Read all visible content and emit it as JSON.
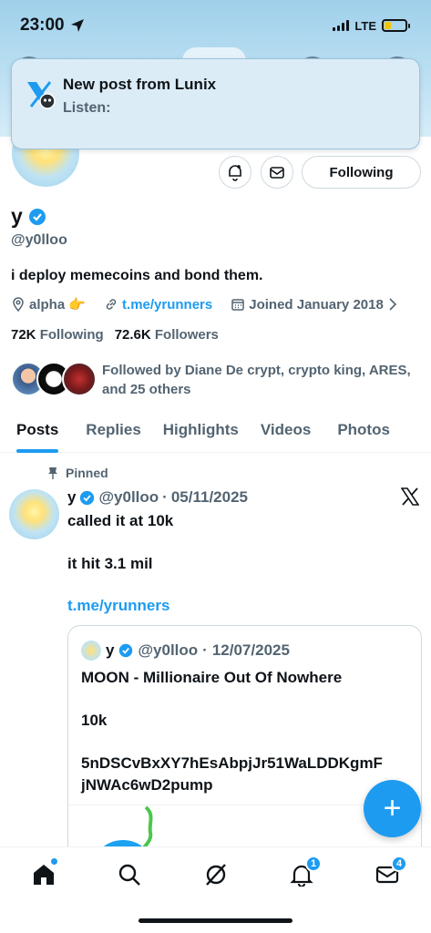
{
  "status_bar": {
    "time": "23:00",
    "network": "LTE"
  },
  "notification": {
    "title": "New post from Lunix",
    "body": "Listen:"
  },
  "profile": {
    "name": "y",
    "handle": "@y0lloo",
    "bio": "i deploy memecoins and bond them.",
    "location": "alpha 👉",
    "link": "t.me/yrunners",
    "joined": "Joined January 2018",
    "following_count": "72K",
    "following_label": "Following",
    "followers_count": "72.6K",
    "followers_label": "Followers",
    "followed_by": "Followed by Diane De crypt, crypto king, ARES, and 25 others",
    "following_button": "Following"
  },
  "tabs": [
    {
      "label": "Posts",
      "active": true
    },
    {
      "label": "Replies"
    },
    {
      "label": "Highlights"
    },
    {
      "label": "Videos"
    },
    {
      "label": "Photos"
    }
  ],
  "pinned_post": {
    "pinned_label": "Pinned",
    "name": "y",
    "handle": "@y0lloo",
    "separator": "·",
    "date": "05/11/2025",
    "line1": "called it at 10k",
    "line2": "it hit 3.1 mil",
    "link": "t.me/yrunners",
    "quote": {
      "name": "y",
      "handle": "@y0lloo",
      "separator": "·",
      "date": "12/07/2025",
      "line1": "MOON - Millionaire Out Of Nowhere",
      "line2": "10k",
      "line3": "5nDSCvBxXY7hEsAbpjJr51WaLDDKgmF",
      "line4": "jNWAc6wD2pump"
    }
  },
  "fab": {
    "label": "+"
  },
  "bottom_nav": {
    "notifications_badge": "1",
    "messages_badge": "4"
  },
  "colors": {
    "accent": "#1d9bf0",
    "text": "#0f1419",
    "secondary": "#536471"
  }
}
